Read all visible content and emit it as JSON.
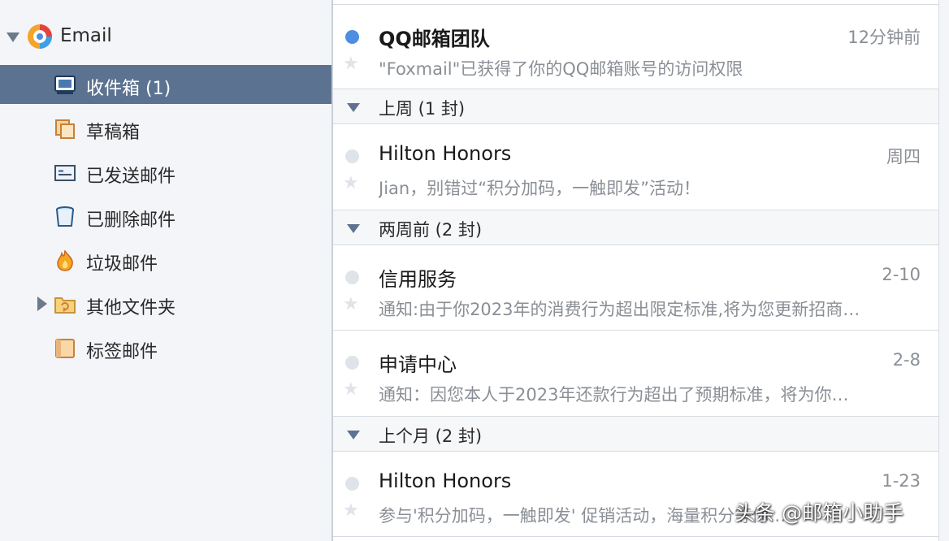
{
  "account": {
    "name": "Email",
    "logo_icon": "qq-mail-logo-icon"
  },
  "folders": [
    {
      "label": "收件箱 (1)",
      "icon": "inbox-icon",
      "selected": true
    },
    {
      "label": "草稿箱",
      "icon": "drafts-icon",
      "selected": false
    },
    {
      "label": "已发送邮件",
      "icon": "sent-icon",
      "selected": false
    },
    {
      "label": "已删除邮件",
      "icon": "trash-icon",
      "selected": false
    },
    {
      "label": "垃圾邮件",
      "icon": "spam-fire-icon",
      "selected": false
    },
    {
      "label": "其他文件夹",
      "icon": "other-folder-icon",
      "selected": false,
      "expandable": true
    },
    {
      "label": "标签邮件",
      "icon": "tag-icon",
      "selected": false
    }
  ],
  "mail_list": {
    "top_mail": {
      "sender": "QQ邮箱团队",
      "time": "12分钟前",
      "preview": "\"Foxmail\"已获得了你的QQ邮箱账号的访问权限",
      "unread": true
    },
    "groups": [
      {
        "label": "上周 (1 封)",
        "mails": [
          {
            "sender": "Hilton Honors",
            "time": "周四",
            "preview": "Jian，别错过“积分加码，一触即发”活动！"
          }
        ]
      },
      {
        "label": "两周前 (2 封)",
        "mails": [
          {
            "sender": "信用服务",
            "time": "2-10",
            "preview": "通知:由于你2023年的消费行为超出限定标准,将为您更新招商…"
          },
          {
            "sender": "申请中心",
            "time": "2-8",
            "preview": "通知：因您本人于2023年还款行为超出了预期标准，将为你…"
          }
        ]
      },
      {
        "label": "上个月 (2 封)",
        "mails": [
          {
            "sender": "Hilton Honors",
            "time": "1-23",
            "preview": "参与'积分加码，一触即发' 促销活动，海量积分等你…"
          }
        ]
      }
    ]
  },
  "watermark": "头条 @邮箱小助手",
  "colors": {
    "sidebar_bg": "#f3f5f8",
    "selected_bg": "#5b7390",
    "unread_dot": "#4e8ee0",
    "read_dot": "#dfe3ea",
    "muted_text": "#8a8f96"
  }
}
